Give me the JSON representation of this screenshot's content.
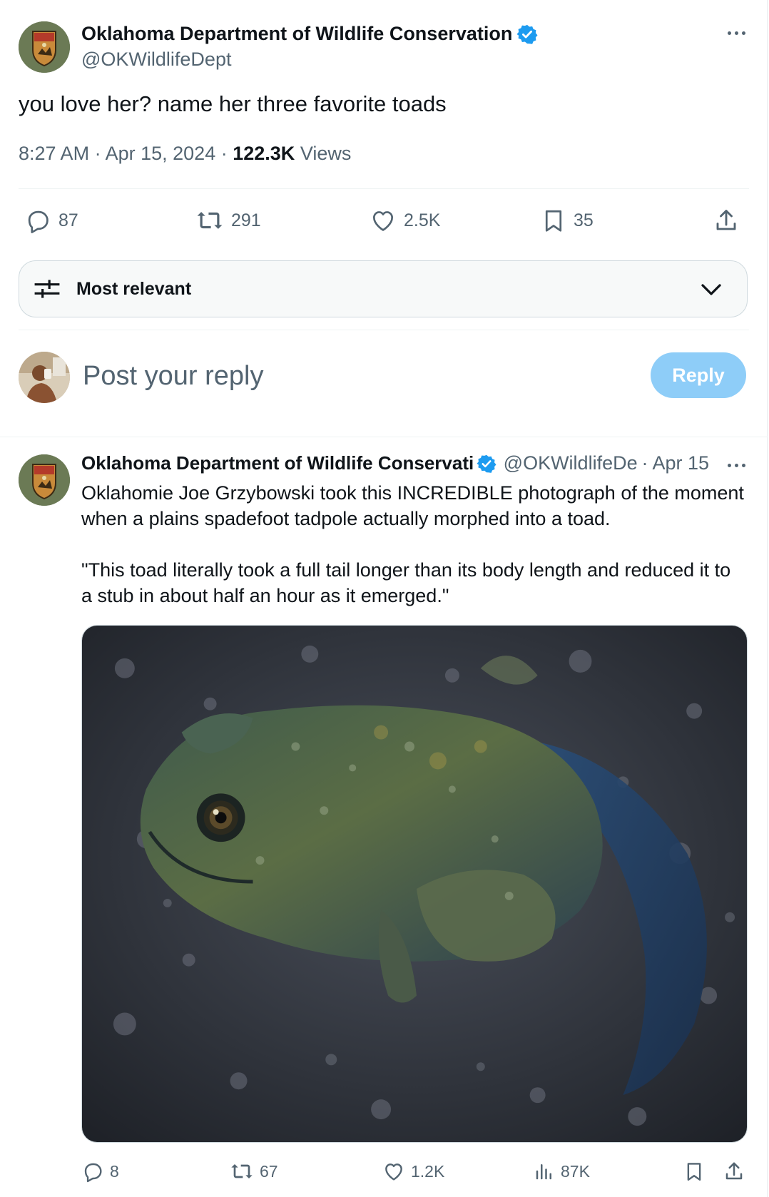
{
  "main_tweet": {
    "author_name": "Oklahoma Department of Wildlife Conservation",
    "handle": "@OKWildlifeDept",
    "text": "you love her? name her three favorite toads",
    "time": "8:27 AM",
    "date": "Apr 15, 2024",
    "views_count": "122.3K",
    "views_label": "Views",
    "actions": {
      "replies": "87",
      "reposts": "291",
      "likes": "2.5K",
      "bookmarks": "35"
    }
  },
  "sort": {
    "label": "Most relevant"
  },
  "composer": {
    "placeholder": "Post your reply",
    "button_label": "Reply"
  },
  "reply_tweet": {
    "author_name": "Oklahoma Department of Wildlife Conservati",
    "handle": "@OKWildlifeDe",
    "date": "Apr 15",
    "paragraph_1": "Oklahomie Joe Grzybowski took this INCREDIBLE photograph of the moment when a plains spadefoot tadpole actually morphed into a toad.",
    "paragraph_2": "\"This toad literally took a full tail longer than its body length and reduced it to a stub in about half an hour as it emerged.\"",
    "actions": {
      "replies": "8",
      "reposts": "67",
      "likes": "1.2K",
      "views": "87K"
    }
  },
  "colors": {
    "verified_blue": "#1d9bf0",
    "reply_button_disabled": "#8ecdf8",
    "secondary_text": "#536471"
  }
}
